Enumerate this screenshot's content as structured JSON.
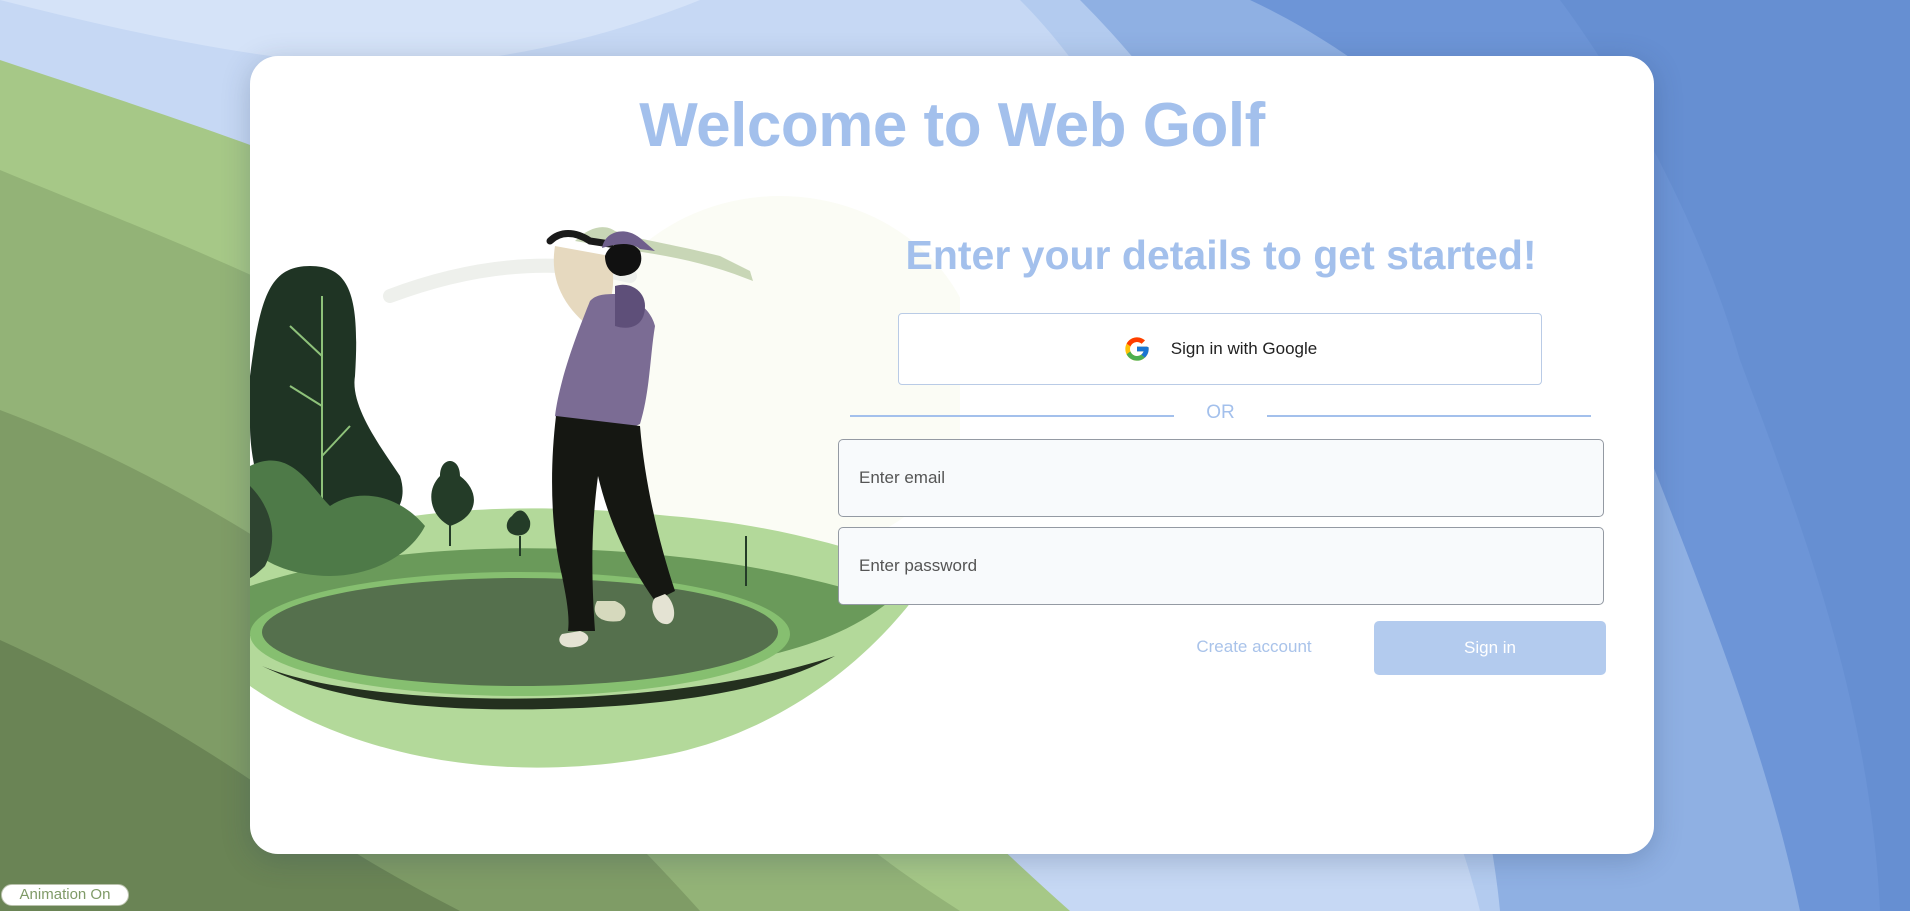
{
  "page": {
    "title": "Welcome to Web Golf",
    "subtitle": "Enter your details to get started!"
  },
  "google": {
    "label": "Sign in with Google",
    "icon": "google-g-icon"
  },
  "divider": {
    "label": "OR"
  },
  "form": {
    "email_placeholder": "Enter email",
    "password_placeholder": "Enter password",
    "create_account_label": "Create account",
    "sign_in_label": "Sign in"
  },
  "animation_toggle": {
    "label": "Animation On"
  },
  "illustration": {
    "subject": "golfer-swing-illustration"
  },
  "colors": {
    "accent": "#a3c0ec",
    "primary_button": "#b3cbee",
    "bg_blue": "#6b96d6",
    "bg_green": "#a5c784"
  }
}
